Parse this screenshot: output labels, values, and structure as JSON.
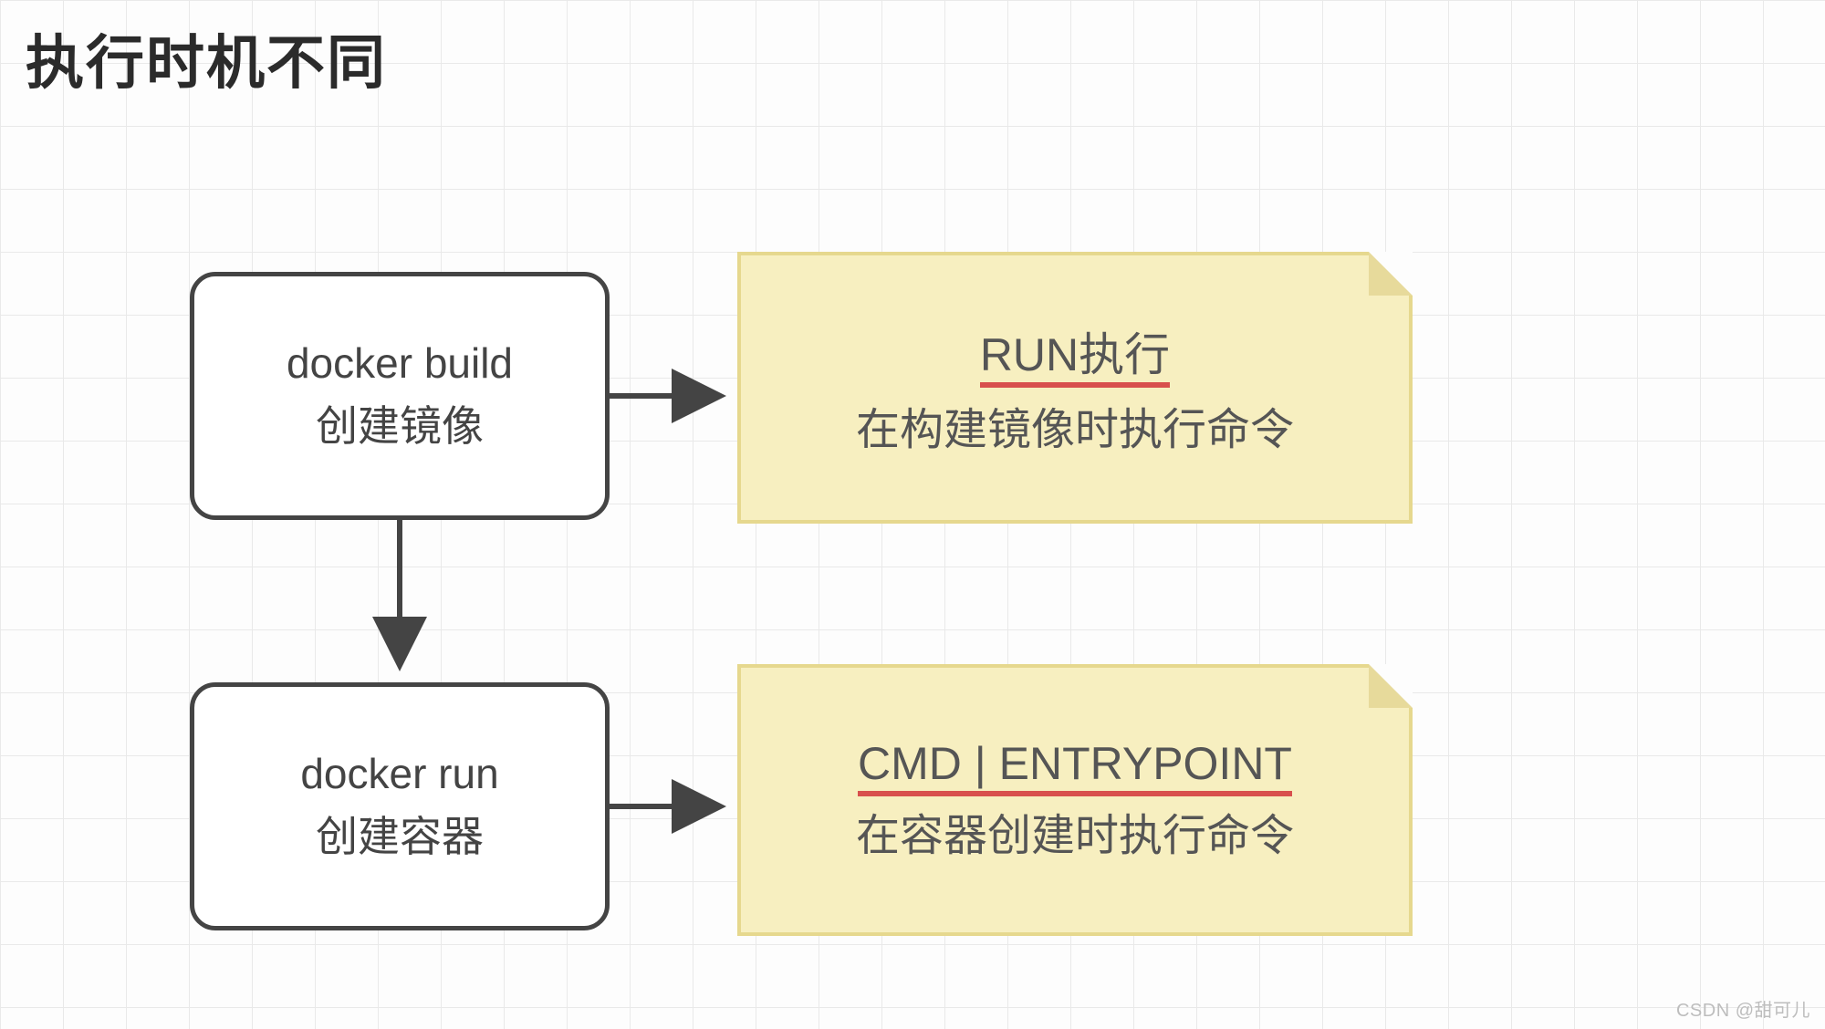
{
  "title": "执行时机不同",
  "left_boxes": [
    {
      "line1": "docker build",
      "line2": "创建镜像"
    },
    {
      "line1": "docker run",
      "line2": "创建容器"
    }
  ],
  "right_notes": [
    {
      "headline": "RUN执行",
      "sub": "在构建镜像时执行命令"
    },
    {
      "headline": "CMD | ENTRYPOINT",
      "sub": "在容器创建时执行命令"
    }
  ],
  "watermark": "CSDN @甜可儿"
}
